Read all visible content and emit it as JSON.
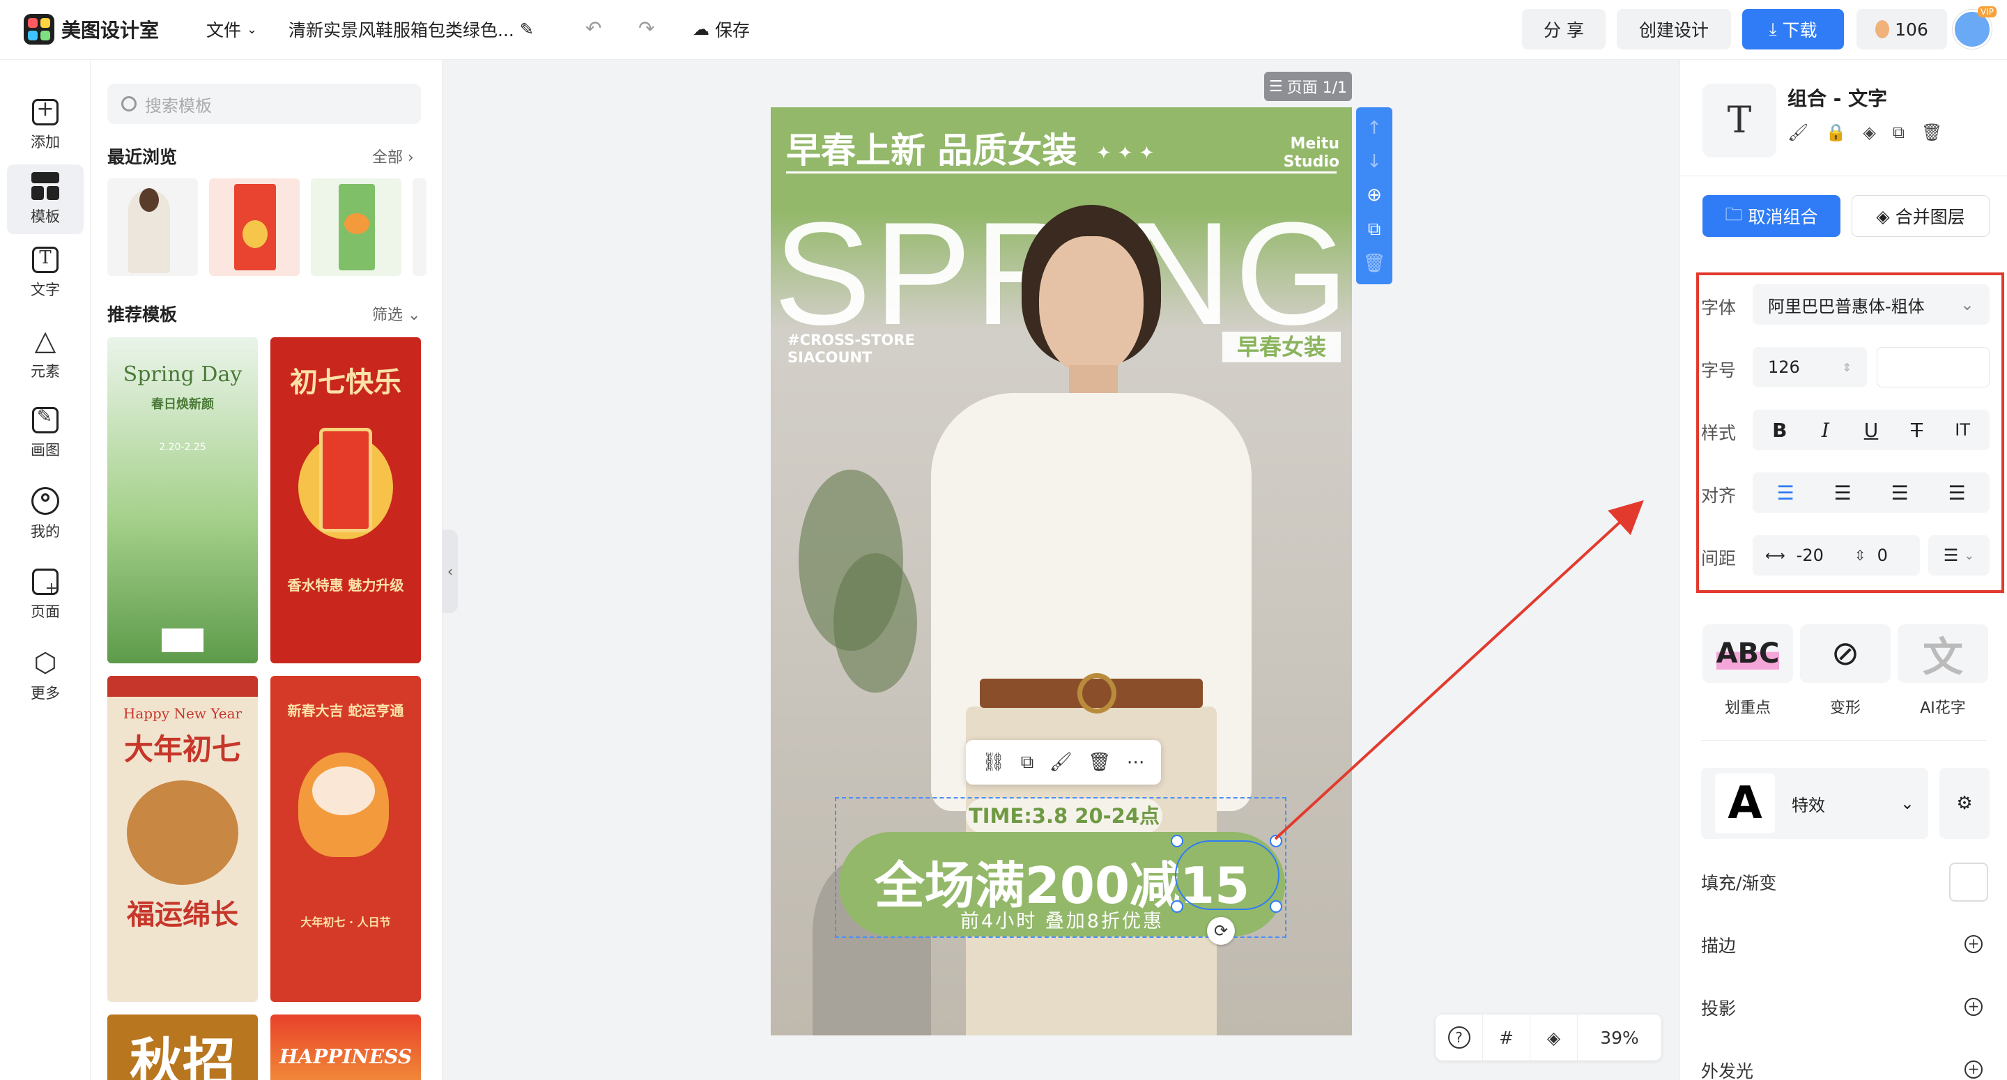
{
  "app": {
    "name": "美图设计室"
  },
  "topbar": {
    "file_menu": "文件",
    "doc_title": "清新实景风鞋服箱包类绿色...",
    "save_label": "保存",
    "share_label": "分 享",
    "create_label": "创建设计",
    "download_label": "下载",
    "credits": "106",
    "vip_badge": "VIP"
  },
  "leftnav": {
    "items": [
      {
        "label": "添加",
        "icon": "plus-square-icon"
      },
      {
        "label": "模板",
        "icon": "template-grid-icon",
        "active": true
      },
      {
        "label": "文字",
        "icon": "text-t-icon"
      },
      {
        "label": "元素",
        "icon": "shapes-icon"
      },
      {
        "label": "画图",
        "icon": "draw-icon"
      },
      {
        "label": "我的",
        "icon": "user-icon"
      },
      {
        "label": "页面",
        "icon": "page-add-icon"
      },
      {
        "label": "更多",
        "icon": "cube-icon"
      }
    ]
  },
  "panel": {
    "search_placeholder": "搜索模板",
    "recent_title": "最近浏览",
    "recent_link": "全部",
    "recommend_title": "推荐模板",
    "recommend_filter": "筛选",
    "templates": [
      {
        "title": "Spring Day",
        "subtitle": "春日焕新颜",
        "date": "2.20-2.25"
      },
      {
        "title": "初七快乐",
        "subtitle": "香水特惠 魅力升级"
      },
      {
        "title": "大年初七",
        "subtitle": "福运绵长",
        "en": "Happy New Year"
      },
      {
        "title": "新春大吉 蛇运亨通",
        "subtitle": "大年初七 · 人日节"
      },
      {
        "title": "秋招"
      },
      {
        "title": "HAPPINESS"
      }
    ]
  },
  "canvas": {
    "page_label": "页面 1/1",
    "poster": {
      "title": "早春上新 品质女装",
      "stars": "✦ ✦ ✦",
      "brand_line1": "Meitu",
      "brand_line2": "Studio",
      "big_text": "SPRING",
      "tag_line1": "#CROSS-STORE",
      "tag_line2": "SIACOUNT",
      "spring_cn": "早春女装",
      "time": "TIME:3.8 20-24点",
      "promo_main": "全场满200减15",
      "promo_sub": "前4小时 叠加8折优惠"
    },
    "zoom": "39%"
  },
  "rpanel": {
    "selection_title": "组合 - 文字",
    "ungroup_label": "取消组合",
    "merge_label": "合并图层",
    "font_label": "字体",
    "font_value": "阿里巴巴普惠体-粗体",
    "size_label": "字号",
    "size_value": "126",
    "style_label": "样式",
    "style_buttons": [
      "B",
      "I",
      "U",
      "T",
      "IT"
    ],
    "align_label": "对齐",
    "spacing_label": "间距",
    "letter_spacing": "-20",
    "line_spacing": "0",
    "effects": [
      {
        "label": "划重点",
        "preview": "ABC"
      },
      {
        "label": "变形",
        "preview": "⊘"
      },
      {
        "label": "AI花字",
        "preview": "文"
      }
    ],
    "effect_preset_label": "特效",
    "effect_preset_preview": "A",
    "rows": [
      "填充/渐变",
      "描边",
      "投影",
      "外发光"
    ]
  },
  "colors": {
    "accent_blue": "#2f7cf6",
    "poster_green": "#93b86a",
    "highlight_red": "#e23b2e"
  }
}
